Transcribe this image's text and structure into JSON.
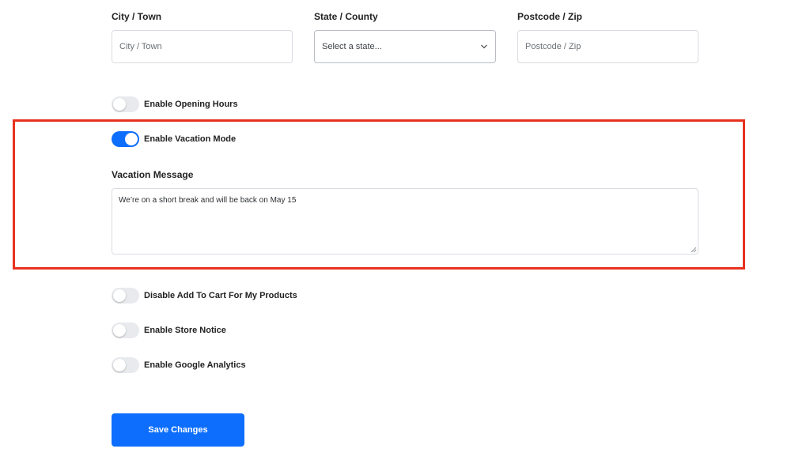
{
  "address": {
    "city": {
      "label": "City / Town",
      "placeholder": "City / Town",
      "value": ""
    },
    "state": {
      "label": "State / County",
      "selected": "Select a state..."
    },
    "postcode": {
      "label": "Postcode / Zip",
      "placeholder": "Postcode / Zip",
      "value": ""
    }
  },
  "toggles": {
    "opening_hours": {
      "label": "Enable Opening Hours",
      "on": false
    },
    "vacation_mode": {
      "label": "Enable Vacation Mode",
      "on": true
    },
    "disable_add_to_cart": {
      "label": "Disable Add To Cart For My Products",
      "on": false
    },
    "store_notice": {
      "label": "Enable Store Notice",
      "on": false
    },
    "google_analytics": {
      "label": "Enable Google Analytics",
      "on": false
    }
  },
  "vacation": {
    "message_label": "Vacation Message",
    "message_value": "We’re on a short break and will be back on May 15"
  },
  "actions": {
    "save_label": "Save Changes"
  },
  "icons": {
    "select_arrow": "chevron-down-icon",
    "textarea_resize": "resize-grip-icon"
  },
  "colors": {
    "accent": "#0d6efd",
    "highlight": "#e8321e",
    "toggle_off": "#e8eaed"
  }
}
